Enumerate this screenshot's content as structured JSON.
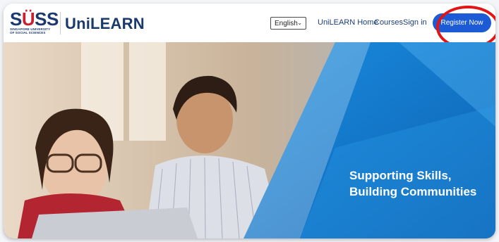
{
  "brand": {
    "suss_main": "SUSS",
    "suss_sub_line1": "SINGAPORE UNIVERSITY",
    "suss_sub_line2": "OF SOCIAL SCIENCES",
    "unilearn": "UniLEARN"
  },
  "header": {
    "language": "English",
    "nav": [
      {
        "label": "UniLEARN Home"
      },
      {
        "label": "Courses"
      },
      {
        "label": "Sign in"
      }
    ],
    "register_label": "Register Now"
  },
  "hero": {
    "tagline_line1": "Supporting Skills,",
    "tagline_line2": "Building Communities"
  },
  "colors": {
    "brand_navy": "#1a3a6e",
    "brand_red": "#c8202f",
    "button_blue": "#1d5bd6",
    "hero_blue": "#1a78c8",
    "highlight_red": "#e11515"
  }
}
